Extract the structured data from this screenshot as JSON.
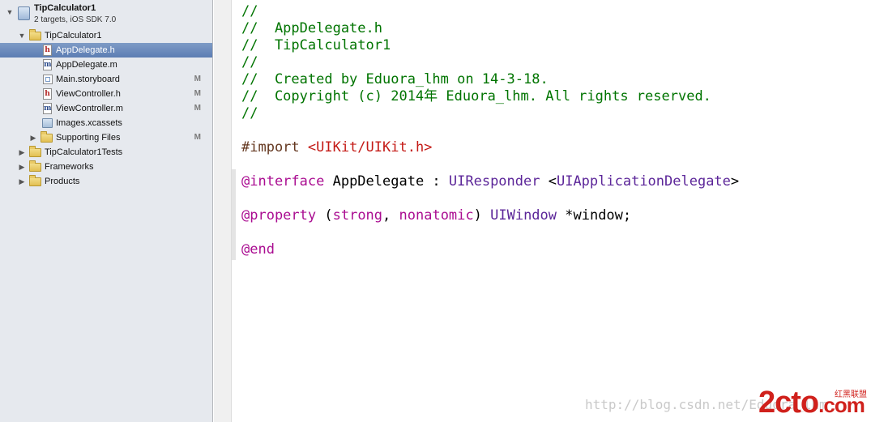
{
  "navigator": {
    "project": {
      "name": "TipCalculator1",
      "subtitle": "2 targets, iOS SDK 7.0"
    },
    "items": [
      {
        "label": "TipCalculator1",
        "icon": "folder-icon",
        "badge": ""
      },
      {
        "label": "AppDelegate.h",
        "icon": "header-file-icon",
        "badge": "",
        "selected": true
      },
      {
        "label": "AppDelegate.m",
        "icon": "implementation-file-icon",
        "badge": ""
      },
      {
        "label": "Main.storyboard",
        "icon": "storyboard-icon",
        "badge": "M"
      },
      {
        "label": "ViewController.h",
        "icon": "header-file-icon",
        "badge": "M"
      },
      {
        "label": "ViewController.m",
        "icon": "implementation-file-icon",
        "badge": "M"
      },
      {
        "label": "Images.xcassets",
        "icon": "asset-catalog-icon",
        "badge": ""
      },
      {
        "label": "Supporting Files",
        "icon": "folder-icon",
        "badge": "M"
      },
      {
        "label": "TipCalculator1Tests",
        "icon": "folder-icon",
        "badge": ""
      },
      {
        "label": "Frameworks",
        "icon": "folder-icon",
        "badge": ""
      },
      {
        "label": "Products",
        "icon": "folder-icon",
        "badge": ""
      }
    ]
  },
  "editor": {
    "lines": [
      [
        {
          "t": "//",
          "c": "comment"
        }
      ],
      [
        {
          "t": "//  AppDelegate.h",
          "c": "comment"
        }
      ],
      [
        {
          "t": "//  TipCalculator1",
          "c": "comment"
        }
      ],
      [
        {
          "t": "//",
          "c": "comment"
        }
      ],
      [
        {
          "t": "//  Created by Eduora_lhm on 14-3-18.",
          "c": "comment"
        }
      ],
      [
        {
          "t": "//  Copyright (c) 2014年 Eduora_lhm. All rights reserved.",
          "c": "comment"
        }
      ],
      [
        {
          "t": "//",
          "c": "comment"
        }
      ],
      [],
      [
        {
          "t": "#import ",
          "c": "preproc"
        },
        {
          "t": "<UIKit/UIKit.h>",
          "c": "string"
        }
      ],
      [],
      [
        {
          "t": "@interface",
          "c": "keyword"
        },
        {
          "t": " AppDelegate : ",
          "c": "plain"
        },
        {
          "t": "UIResponder",
          "c": "type"
        },
        {
          "t": " <",
          "c": "plain"
        },
        {
          "t": "UIApplicationDelegate",
          "c": "type"
        },
        {
          "t": ">",
          "c": "plain"
        }
      ],
      [],
      [
        {
          "t": "@property",
          "c": "keyword"
        },
        {
          "t": " (",
          "c": "plain"
        },
        {
          "t": "strong",
          "c": "keyword"
        },
        {
          "t": ", ",
          "c": "plain"
        },
        {
          "t": "nonatomic",
          "c": "keyword"
        },
        {
          "t": ") ",
          "c": "plain"
        },
        {
          "t": "UIWindow",
          "c": "type"
        },
        {
          "t": " *window;",
          "c": "plain"
        }
      ],
      [],
      [
        {
          "t": "@end",
          "c": "keyword"
        }
      ]
    ]
  },
  "watermark": {
    "url": "http://blog.csdn.net/Eduora_lhm",
    "logo": "2cto",
    "logo_tld": ".com",
    "logo_caption": "红黑联盟"
  }
}
